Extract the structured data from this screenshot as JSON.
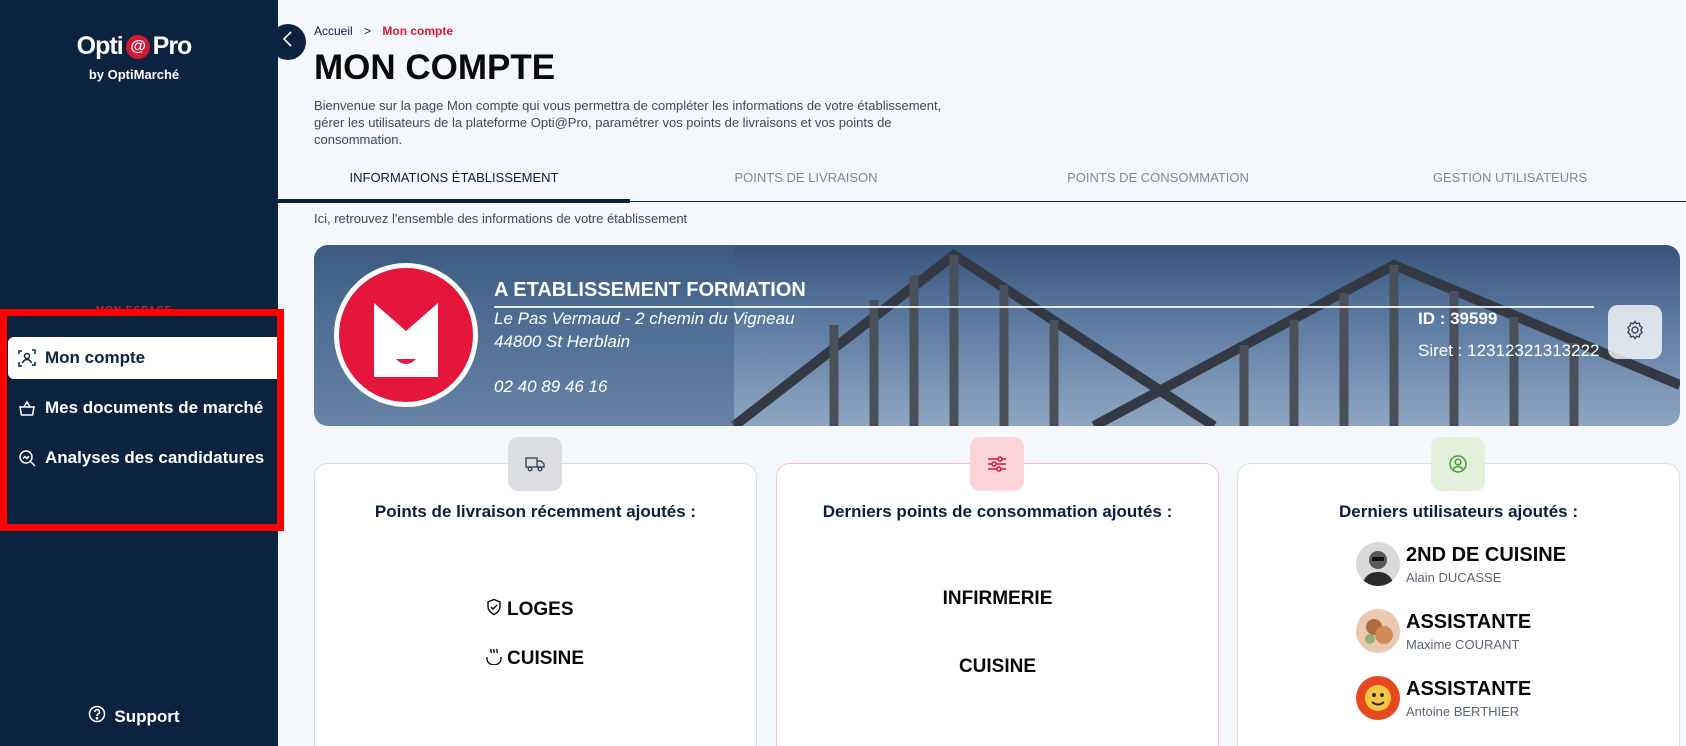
{
  "brand": {
    "name_left": "Opti",
    "name_at": "@",
    "name_right": "Pro",
    "subtitle": "by OptiMarché",
    "accent_color": "#d41937",
    "sidebar_color": "#0c2340"
  },
  "sidebar": {
    "section_label": "MON ESPACE",
    "items": [
      {
        "label": "Mon compte",
        "icon": "user-scan-icon",
        "active": true
      },
      {
        "label": "Mes documents de marché",
        "icon": "basket-icon",
        "active": false
      },
      {
        "label": "Analyses des candidatures",
        "icon": "search-chart-icon",
        "active": false
      }
    ],
    "support_label": "Support"
  },
  "breadcrumb": {
    "home": "Accueil",
    "separator": ">",
    "current": "Mon compte"
  },
  "page": {
    "title": "MON COMPTE",
    "intro": "Bienvenue sur la page Mon compte qui vous permettra de compléter les informations de votre établissement, gérer les utilisateurs de la plateforme Opti@Pro, paramétrer vos points de livraisons et vos points de consommation."
  },
  "tabs": [
    {
      "label": "INFORMATIONS ÉTABLISSEMENT",
      "active": true
    },
    {
      "label": "POINTS DE LIVRAISON",
      "active": false
    },
    {
      "label": "POINTS DE CONSOMMATION",
      "active": false
    },
    {
      "label": "GESTION UTILISATEURS",
      "active": false
    }
  ],
  "tab_description": "Ici, retrouvez l'ensemble des informations de votre établissement",
  "establishment": {
    "name": "A ETABLISSEMENT FORMATION",
    "address_line1": "Le Pas Vermaud - 2 chemin du Vigneau",
    "address_line2": "44800 St Herblain",
    "phone": "02 40 89 46 16",
    "id": "ID : 39599",
    "siret": "Siret : 12312321313222"
  },
  "cards": {
    "delivery": {
      "title": "Points de livraison récemment ajoutés :",
      "badge_icon": "truck-icon",
      "items": [
        {
          "label": "LOGES",
          "icon": "shield-check-icon"
        },
        {
          "label": "CUISINE",
          "icon": "steam-icon"
        }
      ]
    },
    "consumption": {
      "title": "Derniers points de consommation ajoutés :",
      "badge_icon": "sliders-icon",
      "items": [
        "INFIRMERIE",
        "CUISINE"
      ]
    },
    "users": {
      "title": "Derniers utilisateurs ajoutés :",
      "badge_icon": "user-circle-icon",
      "items": [
        {
          "role": "2ND DE CUISINE",
          "name": "Alain DUCASSE"
        },
        {
          "role": "ASSISTANTE",
          "name": "Maxime COURANT"
        },
        {
          "role": "ASSISTANTE",
          "name": "Antoine BERTHIER"
        }
      ]
    }
  }
}
